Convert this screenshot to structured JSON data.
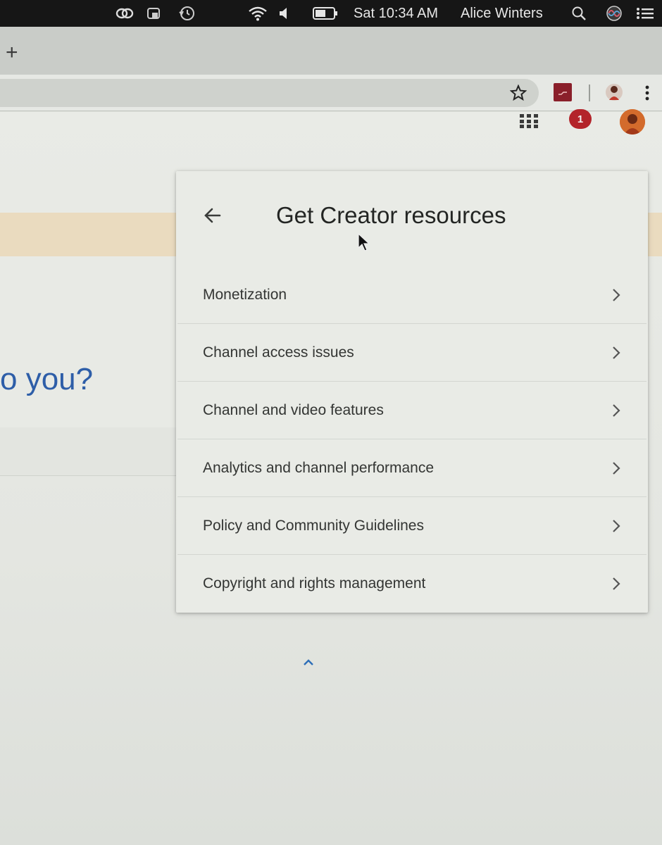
{
  "menubar": {
    "clock": "Sat 10:34 AM",
    "user_name": "Alice Winters",
    "icons": [
      "creative-cloud-icon",
      "backup-icon",
      "time-machine-icon",
      "wifi-icon",
      "volume-icon",
      "battery-icon",
      "spotlight-search-icon",
      "siri-icon",
      "notification-center-icon"
    ]
  },
  "browser": {
    "new_tab_label": "+",
    "toolbar_icons": [
      "bookmark-star-icon",
      "extension-icon",
      "profile-icon",
      "menu-kebab-icon"
    ]
  },
  "page_header": {
    "notification_count": "1",
    "icons": [
      "apps-grid-icon",
      "notification-badge",
      "account-avatar"
    ]
  },
  "hero": {
    "partial_text": "o you?"
  },
  "panel": {
    "title": "Get Creator resources",
    "items": [
      {
        "label": "Monetization"
      },
      {
        "label": "Channel access issues"
      },
      {
        "label": "Channel and video features"
      },
      {
        "label": "Analytics and channel performance"
      },
      {
        "label": "Policy and Community Guidelines"
      },
      {
        "label": "Copyright and rights management"
      }
    ]
  },
  "colors": {
    "accent_blue": "#2e5ea8",
    "badge_red": "#b3242a",
    "banner_yellow": "#eadbbf"
  }
}
